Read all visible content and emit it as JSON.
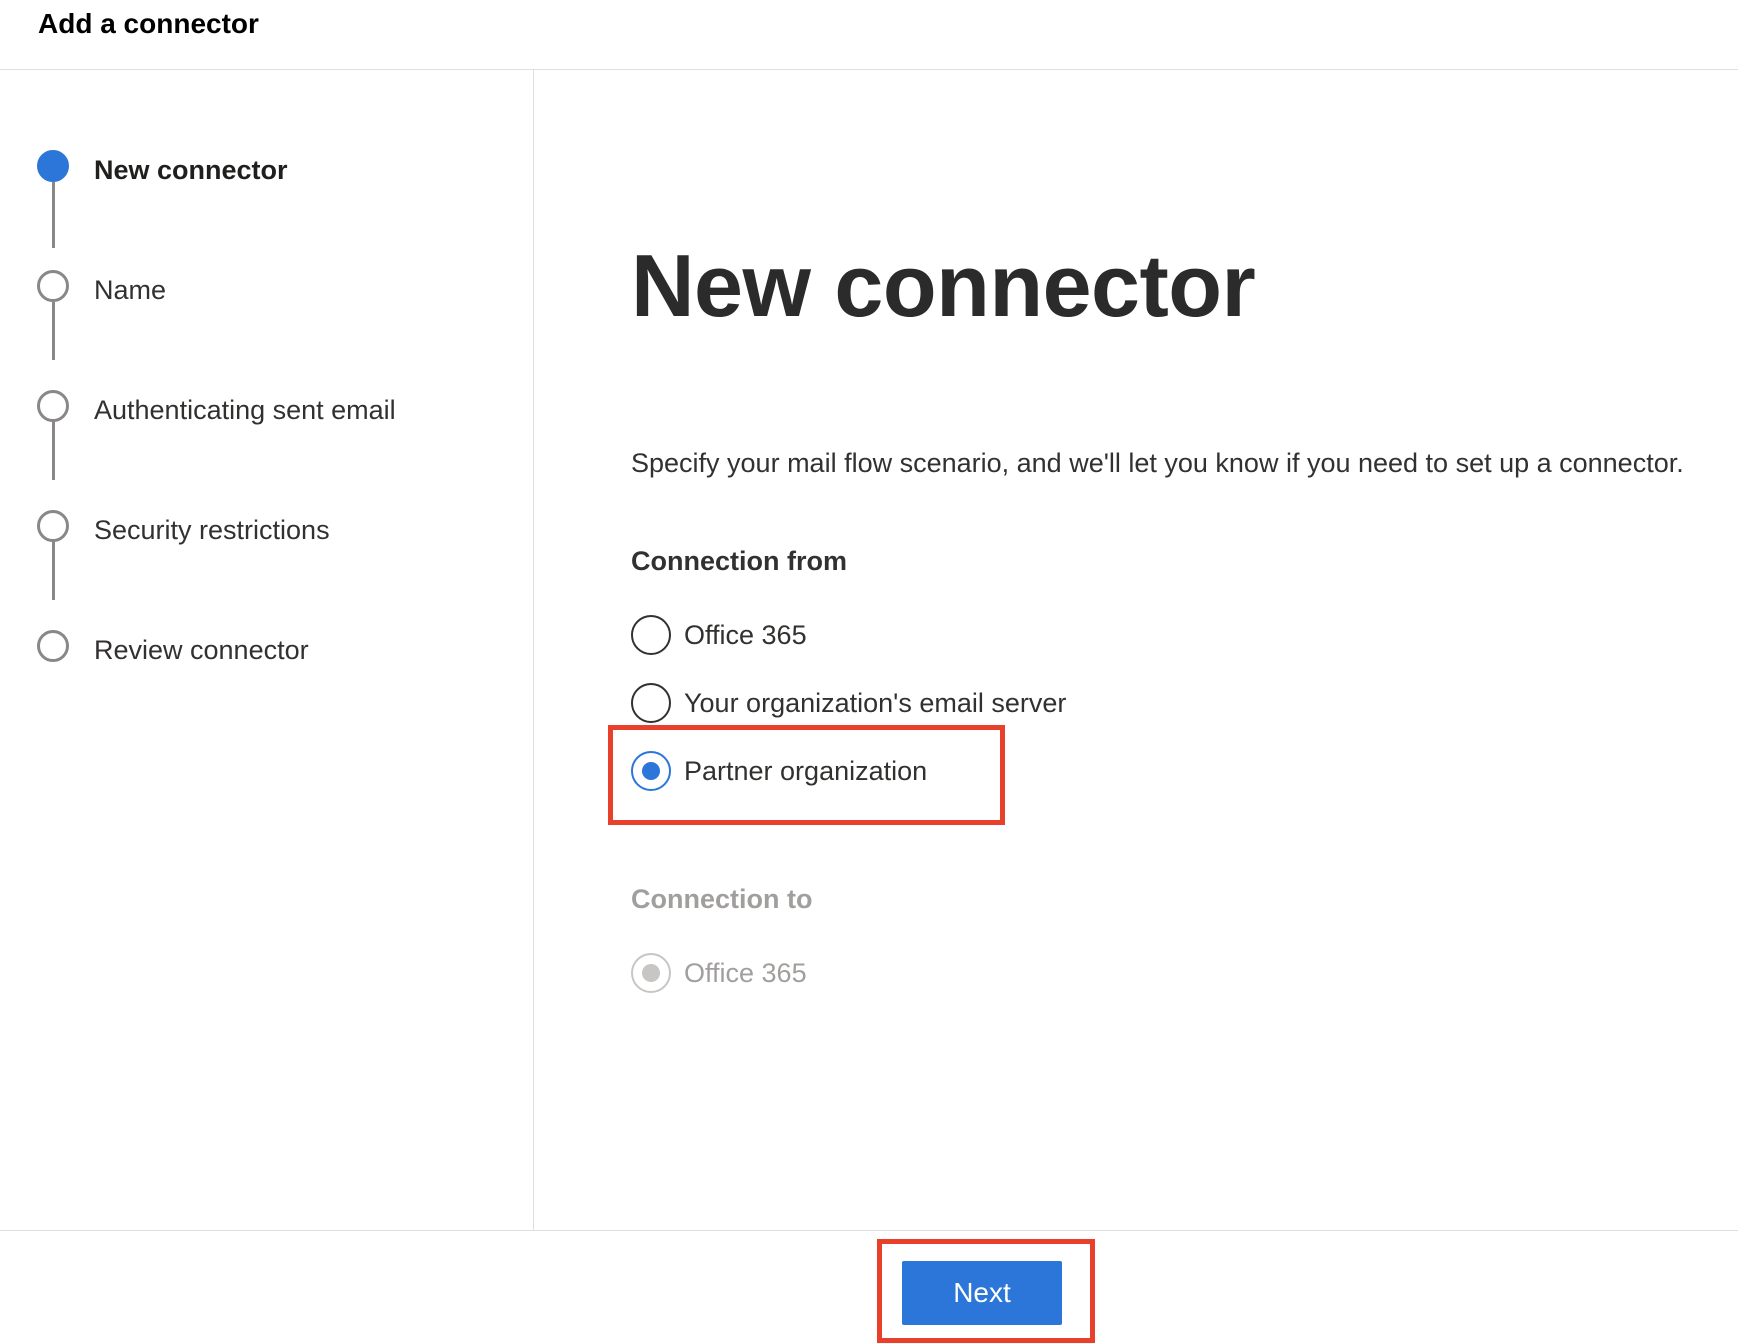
{
  "header": {
    "title": "Add a connector"
  },
  "steps": [
    {
      "label": "New connector",
      "state": "current"
    },
    {
      "label": "Name",
      "state": "pending"
    },
    {
      "label": "Authenticating sent email",
      "state": "pending"
    },
    {
      "label": "Security restrictions",
      "state": "pending"
    },
    {
      "label": "Review connector",
      "state": "pending"
    }
  ],
  "main": {
    "title": "New connector",
    "description": "Specify your mail flow scenario, and we'll let you know if you need to set up a connector.",
    "connection_from": {
      "label": "Connection from",
      "options": [
        {
          "label": "Office 365",
          "checked": false
        },
        {
          "label": "Your organization's email server",
          "checked": false
        },
        {
          "label": "Partner organization",
          "checked": true
        }
      ]
    },
    "connection_to": {
      "label": "Connection to",
      "options": [
        {
          "label": "Office 365",
          "checked": true,
          "disabled": true
        }
      ]
    }
  },
  "footer": {
    "next_label": "Next"
  },
  "colors": {
    "accent": "#2b76d8",
    "highlight": "#e8402a"
  }
}
